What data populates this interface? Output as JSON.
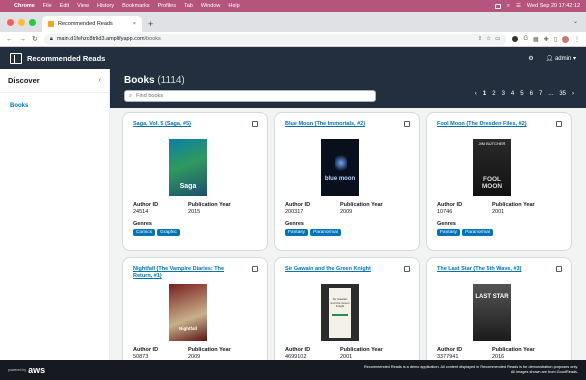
{
  "mac_menu": {
    "apple": "",
    "items": [
      "Chrome",
      "File",
      "Edit",
      "View",
      "History",
      "Bookmarks",
      "Profiles",
      "Tab",
      "Window",
      "Help"
    ],
    "datetime": "Wed Sep 20  17:42:12"
  },
  "browser": {
    "tab_title": "Recommended Reads",
    "tab_close": "×",
    "new_tab": "+",
    "url": "main.d1fehzc8trlid3.amplifyapp.com",
    "url_path": "/books"
  },
  "app": {
    "title": "Recommended Reads",
    "user": "admin"
  },
  "sidebar": {
    "title": "Discover",
    "collapse_glyph": "‹",
    "items": [
      {
        "label": "Books"
      }
    ]
  },
  "main": {
    "title": "Books",
    "count": "(1114)",
    "search_placeholder": "Find books",
    "pagination": {
      "prev": "‹",
      "pages": [
        "1",
        "2",
        "3",
        "4",
        "5",
        "6",
        "7",
        "..."
      ],
      "last": "35",
      "next": "›"
    }
  },
  "labels": {
    "author_id": "Author ID",
    "publication_year": "Publication Year",
    "genres": "Genres"
  },
  "books": [
    {
      "title": "Saga, Vol. 5 (Saga, #5)",
      "author_id": "24514",
      "year": "2015",
      "genres": [
        "Comics",
        "Graphic"
      ],
      "cover_text": "Saga"
    },
    {
      "title": "Blue Moon (The Immortals, #2)",
      "author_id": "200317",
      "year": "2009",
      "genres": [
        "Fantasy",
        "Paranormal"
      ],
      "cover_text": "blue moon"
    },
    {
      "title": "Fool Moon (The Dresden Files, #2)",
      "author_id": "10746",
      "year": "2001",
      "genres": [
        "Fantasy",
        "Paranormal"
      ],
      "cover_author": "JIM BUTCHER",
      "cover_text": "FOOL MOON"
    },
    {
      "title": "Nightfall (The Vampire Diaries: The Return, #1)",
      "author_id": "50873",
      "year": "2009",
      "genres": [],
      "cover_text": "Nightfall"
    },
    {
      "title": "Sir Gawain and the Green Knight",
      "author_id": "4699102",
      "year": "2001",
      "genres": [],
      "cover_text": "Sir Gawain and the Green Knight"
    },
    {
      "title": "The Last Star (The 5th Wave, #3)",
      "author_id": "3377941",
      "year": "2016",
      "genres": [],
      "cover_text": "LAST STAR"
    }
  ],
  "footer": {
    "powered": "powered by",
    "brand": "aws",
    "disclaimer_1": "Recommended Reads is a demo application. All content displayed in Recommended Reads is for demonstration purposes only.",
    "disclaimer_2": "All images shown are from GoodReads."
  },
  "colors": {
    "accent": "#0073bb",
    "header": "#232f3e",
    "mac_bar": "#b5547c"
  }
}
